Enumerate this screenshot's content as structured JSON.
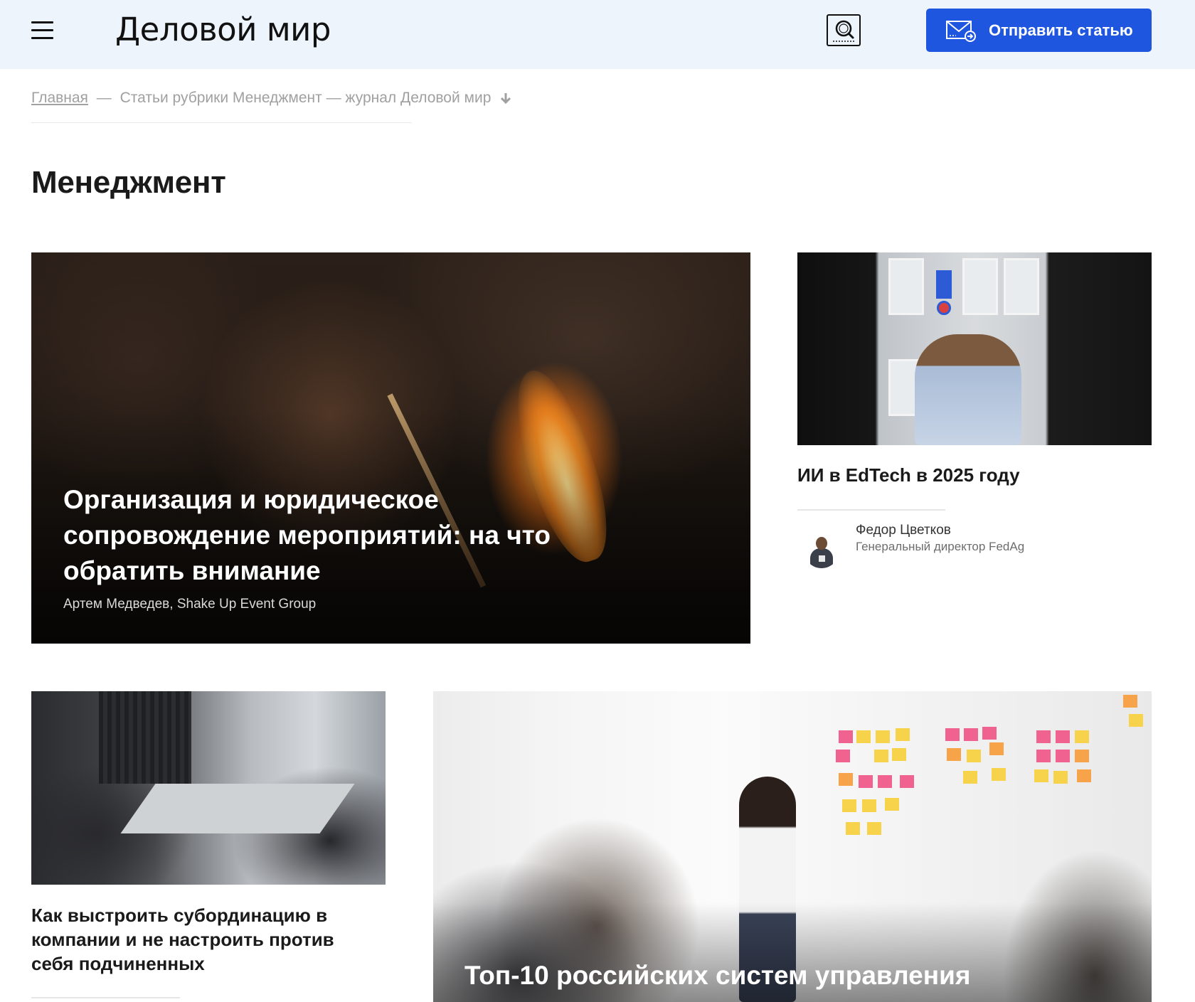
{
  "header": {
    "logo": "Деловой мир",
    "send_button_label": "Отправить статью"
  },
  "breadcrumb": {
    "home": "Главная",
    "separator": "—",
    "current": "Статьи рубрики Менеджмент — журнал Деловой мир"
  },
  "page_title": "Менеджмент",
  "articles": {
    "hero": {
      "title": "Организация и юридическое сопровождение мероприятий: на что обратить внимание",
      "author": "Артем Медведев, Shake Up Event Group"
    },
    "side": {
      "title": "ИИ в EdTech в 2025 году",
      "author_name": "Федор Цветков",
      "author_role": "Генеральный директор FedAg"
    },
    "bottom_left": {
      "title": "Как выстроить субординацию в компании и не настроить против себя подчиненных"
    },
    "bottom_right": {
      "title": "Топ-10 российских систем управления"
    }
  },
  "icons": {
    "menu": "hamburger-menu-icon",
    "search": "search-icon",
    "send": "envelope-icon",
    "breadcrumb_arrow": "arrow-down-icon"
  },
  "colors": {
    "header_bg": "#edf4fb",
    "accent": "#1f56e0",
    "text": "#1a1a1a",
    "muted": "#a0a0a0"
  }
}
